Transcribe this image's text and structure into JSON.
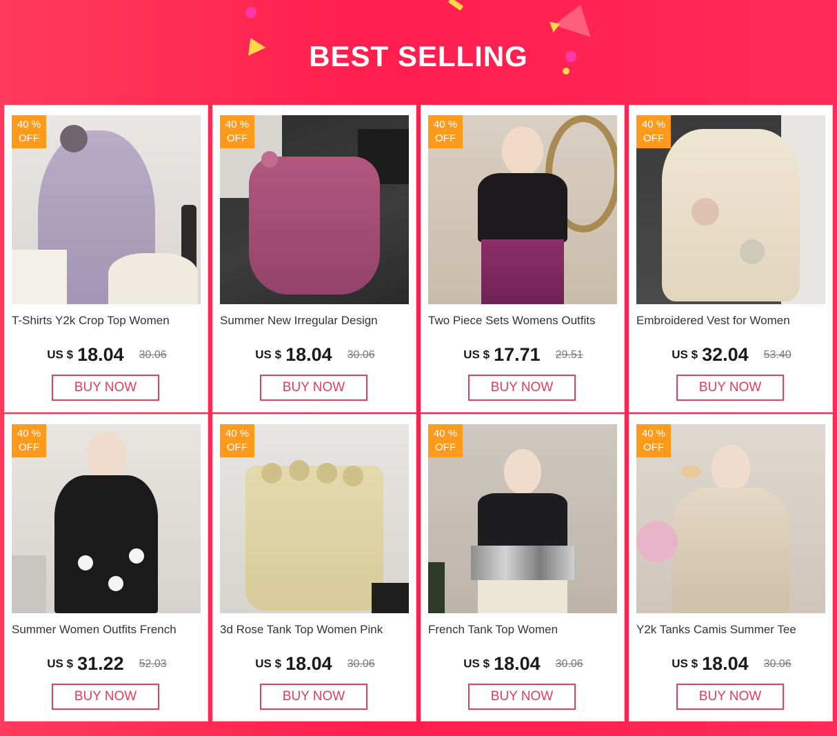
{
  "header": {
    "title": "BEST SELLING"
  },
  "colors": {
    "background": "#ff2550",
    "badge": "#ff9a1a",
    "button_border": "#e0405a",
    "button_text": "#e0405a"
  },
  "products": [
    {
      "badge_percent": "40  %",
      "badge_off": "OFF",
      "title": "T-Shirts Y2k Crop Top Women",
      "currency": "US $",
      "price": "18.04",
      "old_price": "30.06",
      "button": "BUY NOW",
      "image_icon": "lavender-sleeveless-top-photo"
    },
    {
      "badge_percent": "40  %",
      "badge_off": "OFF",
      "title": "Summer New Irregular Design",
      "currency": "US $",
      "price": "18.04",
      "old_price": "30.06",
      "button": "BUY NOW",
      "image_icon": "pink-ruffle-cami-photo"
    },
    {
      "badge_percent": "40  %",
      "badge_off": "OFF",
      "title": "Two Piece Sets Womens Outfits",
      "currency": "US $",
      "price": "17.71",
      "old_price": "29.51",
      "button": "BUY NOW",
      "image_icon": "black-top-purple-skirt-photo"
    },
    {
      "badge_percent": "40  %",
      "badge_off": "OFF",
      "title": "Embroidered Vest for Women",
      "currency": "US $",
      "price": "32.04",
      "old_price": "53.40",
      "button": "BUY NOW",
      "image_icon": "embroidered-vest-photo"
    },
    {
      "badge_percent": "40  %",
      "badge_off": "OFF",
      "title": "Summer Women Outfits French",
      "currency": "US $",
      "price": "31.22",
      "old_price": "52.03",
      "button": "BUY NOW",
      "image_icon": "black-flower-dress-photo"
    },
    {
      "badge_percent": "40  %",
      "badge_off": "OFF",
      "title": "3d Rose Tank Top Women Pink",
      "currency": "US $",
      "price": "18.04",
      "old_price": "30.06",
      "button": "BUY NOW",
      "image_icon": "rose-tube-top-photo"
    },
    {
      "badge_percent": "40  %",
      "badge_off": "OFF",
      "title": "French Tank Top Women",
      "currency": "US $",
      "price": "18.04",
      "old_price": "30.06",
      "button": "BUY NOW",
      "image_icon": "sequin-tank-top-photo"
    },
    {
      "badge_percent": "40  %",
      "badge_off": "OFF",
      "title": "Y2k Tanks Camis Summer Tee",
      "currency": "US $",
      "price": "18.04",
      "old_price": "30.06",
      "button": "BUY NOW",
      "image_icon": "sequin-camis-photo"
    }
  ]
}
